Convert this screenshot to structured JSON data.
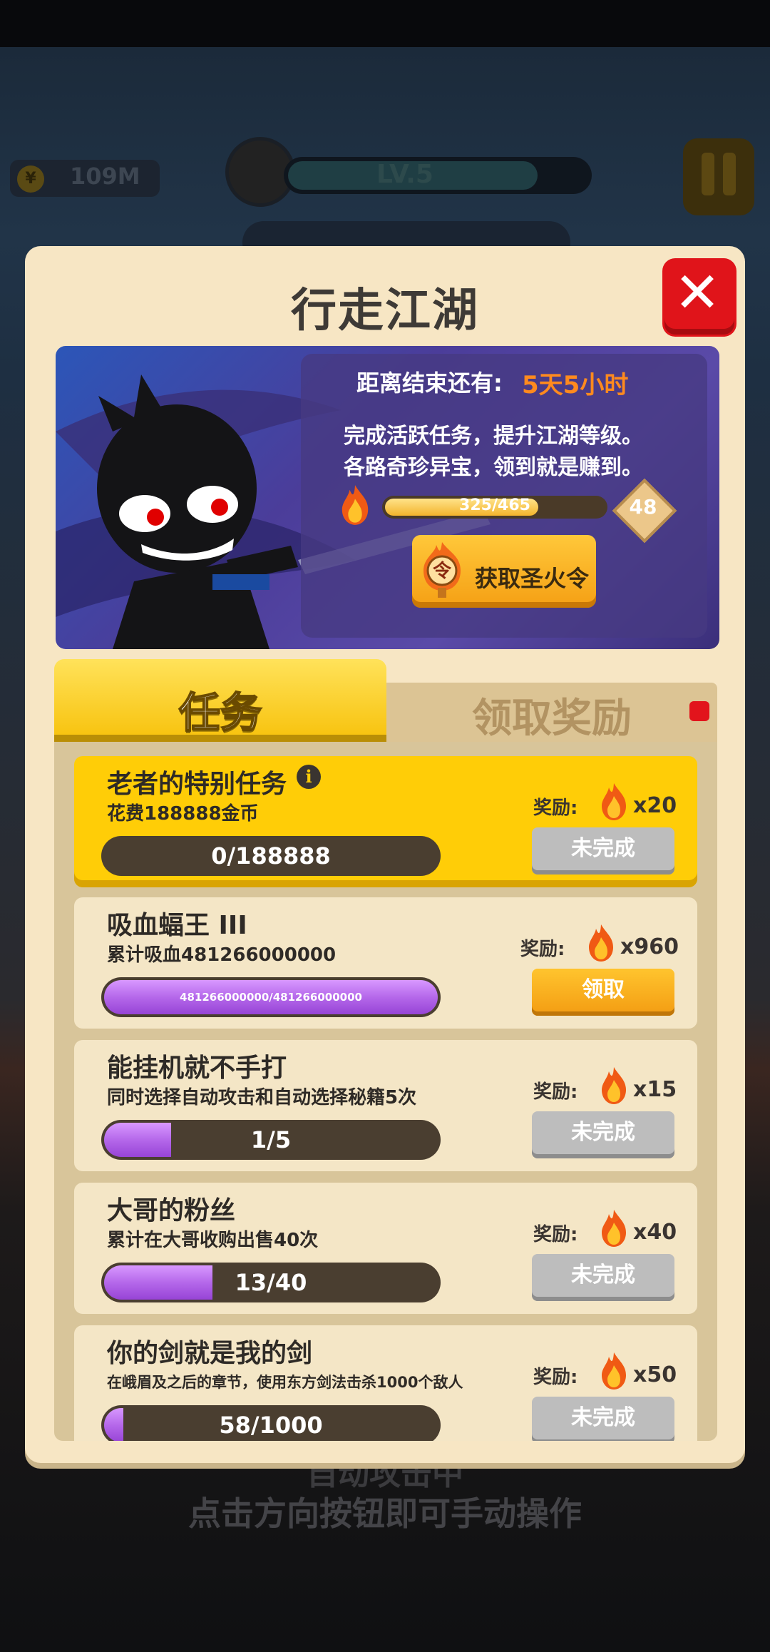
{
  "background": {
    "coins": "109M",
    "coin_icon": "coin-icon",
    "level": "LV.5",
    "hint_line1": "自动攻击中",
    "hint_line2": "点击方向按钮即可手动操作"
  },
  "dialog": {
    "title": "行走江湖",
    "close_icon": "close-icon",
    "banner": {
      "countdown_label": "距离结束还有:",
      "countdown_value": "5天5小时",
      "desc_line1": "完成活跃任务，提升江湖等级。",
      "desc_line2": "各路奇珍异宝，领到就是赚到。",
      "progress_text": "325/465",
      "progress_fraction": 0.699,
      "level": "48",
      "token_glyph": "令",
      "get_token_label": "获取圣火令"
    },
    "tabs": [
      {
        "label": "任务",
        "active": true
      },
      {
        "label": "领取奖励",
        "active": false,
        "badge": true
      }
    ],
    "reward_label": "奖励:",
    "tasks": [
      {
        "title": "老者的特别任务",
        "info_glyph": "i",
        "desc": "花费188888金币",
        "progress_text": "0/188888",
        "progress_fraction": 0.0,
        "reward": "x20",
        "button": "未完成",
        "highlight": true
      },
      {
        "title": "吸血蝠王 III",
        "desc": "累计吸血481266000000",
        "progress_text": "481266000000/481266000000",
        "progress_fraction": 1.0,
        "reward": "x960",
        "button": "领取",
        "highlight": false
      },
      {
        "title": "能挂机就不手打",
        "desc": "同时选择自动攻击和自动选择秘籍5次",
        "progress_text": "1/5",
        "progress_fraction": 0.2,
        "reward": "x15",
        "button": "未完成",
        "highlight": false
      },
      {
        "title": "大哥的粉丝",
        "desc": "累计在大哥收购出售40次",
        "progress_text": "13/40",
        "progress_fraction": 0.325,
        "reward": "x40",
        "button": "未完成",
        "highlight": false
      },
      {
        "title": "你的剑就是我的剑",
        "desc": "在峨眉及之后的章节，使用东方剑法击杀1000个敌人",
        "progress_text": "58/1000",
        "progress_fraction": 0.058,
        "reward": "x50",
        "button": "未完成",
        "highlight": false
      }
    ]
  },
  "colors": {
    "panel": "#f7e6c4",
    "tab_active": "#ffcd07",
    "close_red": "#e0141a",
    "countdown_orange": "#ff8a1e",
    "progress_purple": "#b568ea",
    "button_gold": "#f39c12",
    "button_gray": "#bdbdbd"
  }
}
